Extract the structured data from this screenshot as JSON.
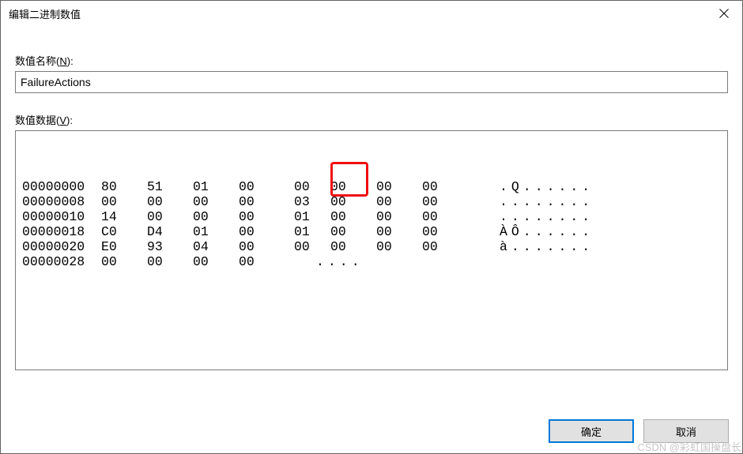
{
  "title": "编辑二进制数值",
  "labels": {
    "value_name": "数值名称(N):",
    "value_data": "数值数据(V):"
  },
  "value_name": "FailureActions",
  "hex": {
    "rows": [
      {
        "offset": "00000000",
        "bytes": [
          "80",
          "51",
          "01",
          "00",
          "00",
          "00",
          "00",
          "00"
        ],
        "ascii": ".Q......"
      },
      {
        "offset": "00000008",
        "bytes": [
          "00",
          "00",
          "00",
          "00",
          "03",
          "00",
          "00",
          "00"
        ],
        "ascii": "........"
      },
      {
        "offset": "00000010",
        "bytes": [
          "14",
          "00",
          "00",
          "00",
          "01",
          "00",
          "00",
          "00"
        ],
        "ascii": "........"
      },
      {
        "offset": "00000018",
        "bytes": [
          "C0",
          "D4",
          "01",
          "00",
          "01",
          "00",
          "00",
          "00"
        ],
        "ascii": "ÀÔ......"
      },
      {
        "offset": "00000020",
        "bytes": [
          "E0",
          "93",
          "04",
          "00",
          "00",
          "00",
          "00",
          "00"
        ],
        "ascii": "à......."
      },
      {
        "offset": "00000028",
        "bytes": [
          "00",
          "00",
          "00",
          "00"
        ],
        "ascii": "...."
      }
    ]
  },
  "buttons": {
    "ok": "确定",
    "cancel": "取消"
  },
  "highlight": {
    "description": "red-rectangle over bytes at 00000010 col5 (01) and 00000018 col5 (01)"
  },
  "watermark": "CSDN @彩虹国操盘长"
}
